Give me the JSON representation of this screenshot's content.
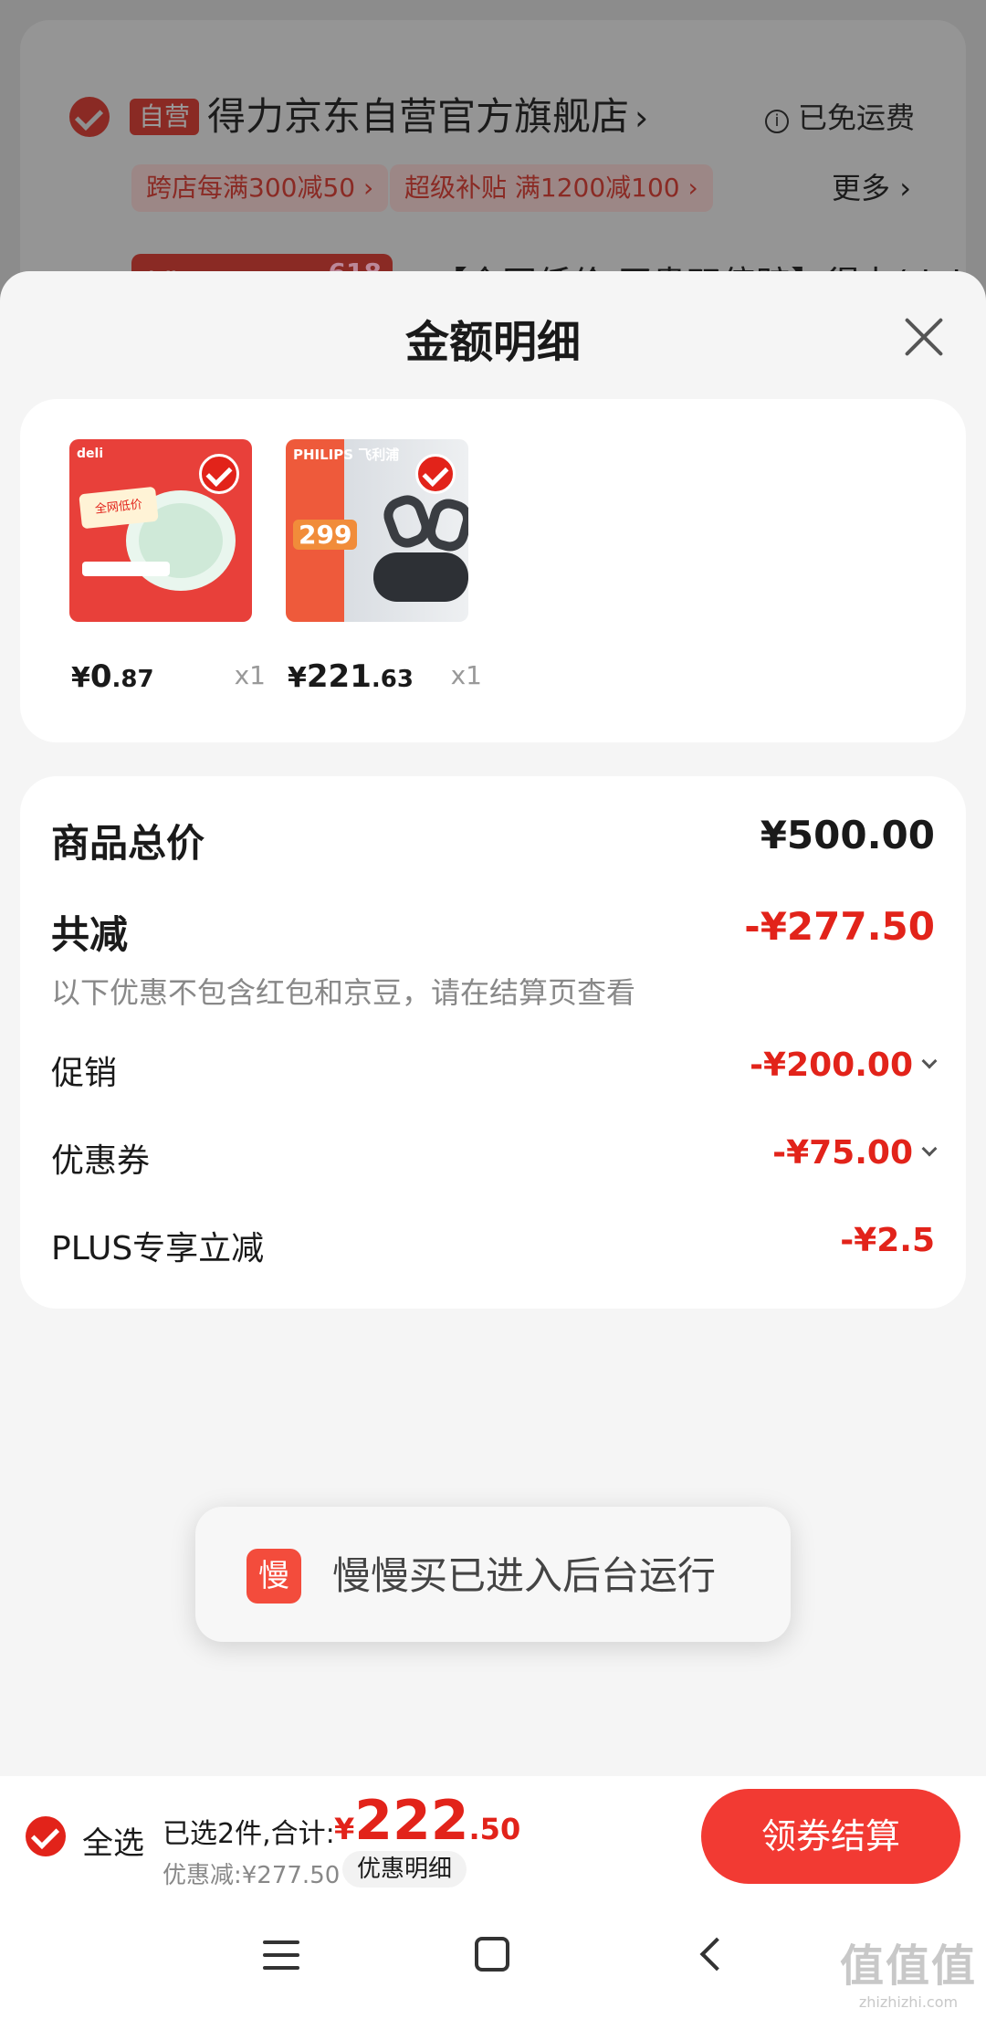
{
  "background": {
    "store_tag": "自营",
    "store_name": "得力京东自营官方旗舰店",
    "free_shipping": "已免运费",
    "promos": [
      "跨店每满300减50 ›",
      "超级补贴 满1200减100 ›"
    ],
    "more": "更多 ›",
    "product_badge": "618",
    "product_brand": "deli",
    "product_title": "【全网低价 买贵双倍赔】得力(del"
  },
  "sheet": {
    "title": "金额明细"
  },
  "products": [
    {
      "image_label": "全网低价",
      "brand": "deli",
      "price_yen": "¥",
      "price_int": "0",
      "price_dec": ".87",
      "qty": "x1"
    },
    {
      "image_label": "299",
      "brand": "PHILIPS 飞利浦",
      "price_yen": "¥",
      "price_int": "221",
      "price_dec": ".63",
      "qty": "x1"
    }
  ],
  "details": {
    "total_label": "商品总价",
    "total_value": "¥500.00",
    "reduce_label": "共减",
    "reduce_value": "-¥277.50",
    "note": "以下优惠不包含红包和京豆，请在结算页查看",
    "promo_label": "促销",
    "promo_value": "-¥200.00",
    "coupon_label": "优惠券",
    "coupon_value": "-¥75.00",
    "plus_label": "PLUS专享立减",
    "plus_value": "-¥2.5"
  },
  "toast": {
    "icon_char": "慢",
    "text": "慢慢买已进入后台运行"
  },
  "bottom_bar": {
    "select_all": "全选",
    "selected": "已选2件,合计:",
    "sum_yen": "¥",
    "sum_int": "222",
    "sum_dec": ".50",
    "discount": "优惠减:¥277.50",
    "detail_link": "优惠明细",
    "checkout": "领券结算"
  },
  "watermark": {
    "main": "值值值",
    "sub": "zhizhizhi.com"
  },
  "colors": {
    "accent_red": "#e2231a",
    "checkout_button": "#f23a33",
    "sheet_bg": "#f5f5f5"
  }
}
